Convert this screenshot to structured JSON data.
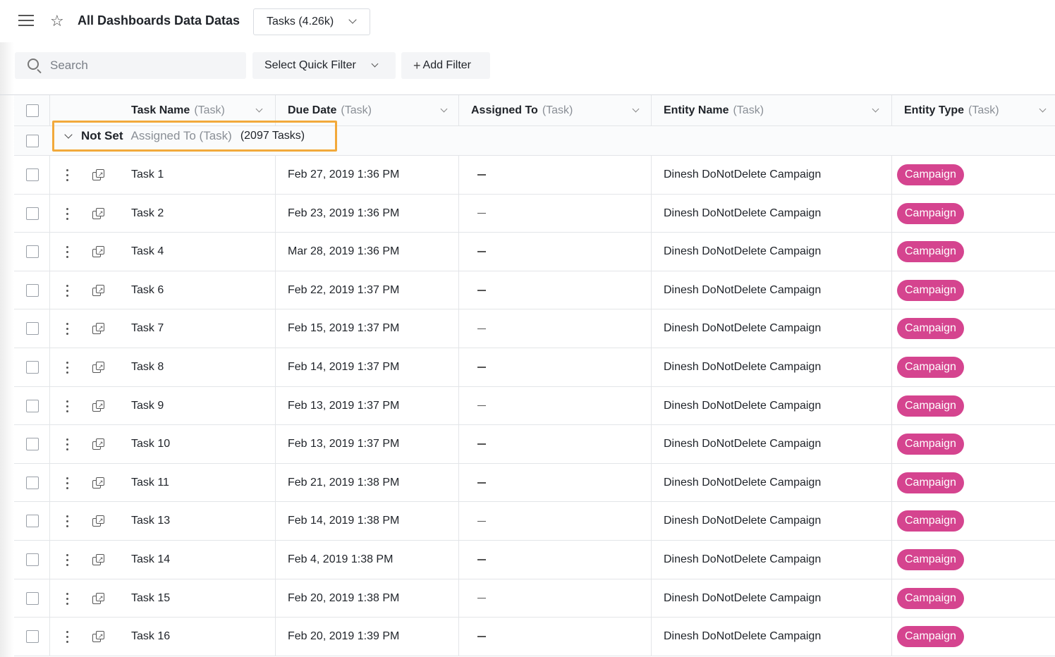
{
  "header": {
    "title": "All Dashboards Data Datas",
    "view_selector": "Tasks (4.26k)"
  },
  "filters": {
    "search_placeholder": "Search",
    "quick_filter_label": "Select Quick Filter",
    "add_filter_label": "Add Filter"
  },
  "table": {
    "columns": [
      {
        "name": "Task Name",
        "entity": "(Task)"
      },
      {
        "name": "Due Date",
        "entity": "(Task)"
      },
      {
        "name": "Assigned To",
        "entity": "(Task)"
      },
      {
        "name": "Entity Name",
        "entity": "(Task)"
      },
      {
        "name": "Entity Type",
        "entity": "(Task)"
      }
    ],
    "group": {
      "value": "Not Set",
      "field": "Assigned To (Task)",
      "count": "(2097 Tasks)"
    },
    "rows": [
      {
        "task": "Task 1",
        "due": "Feb 27, 2019 1:36 PM",
        "entity_name": "Dinesh DoNotDelete Campaign",
        "entity_type": "Campaign"
      },
      {
        "task": "Task 2",
        "due": "Feb 23, 2019 1:36 PM",
        "entity_name": "Dinesh DoNotDelete Campaign",
        "entity_type": "Campaign"
      },
      {
        "task": "Task 4",
        "due": "Mar 28, 2019 1:36 PM",
        "entity_name": "Dinesh DoNotDelete Campaign",
        "entity_type": "Campaign"
      },
      {
        "task": "Task 6",
        "due": "Feb 22, 2019 1:37 PM",
        "entity_name": "Dinesh DoNotDelete Campaign",
        "entity_type": "Campaign"
      },
      {
        "task": "Task 7",
        "due": "Feb 15, 2019 1:37 PM",
        "entity_name": "Dinesh DoNotDelete Campaign",
        "entity_type": "Campaign"
      },
      {
        "task": "Task 8",
        "due": "Feb 14, 2019 1:37 PM",
        "entity_name": "Dinesh DoNotDelete Campaign",
        "entity_type": "Campaign"
      },
      {
        "task": "Task 9",
        "due": "Feb 13, 2019 1:37 PM",
        "entity_name": "Dinesh DoNotDelete Campaign",
        "entity_type": "Campaign"
      },
      {
        "task": "Task 10",
        "due": "Feb 13, 2019 1:37 PM",
        "entity_name": "Dinesh DoNotDelete Campaign",
        "entity_type": "Campaign"
      },
      {
        "task": "Task 11",
        "due": "Feb 21, 2019 1:38 PM",
        "entity_name": "Dinesh DoNotDelete Campaign",
        "entity_type": "Campaign"
      },
      {
        "task": "Task 13",
        "due": "Feb 14, 2019 1:38 PM",
        "entity_name": "Dinesh DoNotDelete Campaign",
        "entity_type": "Campaign"
      },
      {
        "task": "Task 14",
        "due": "Feb 4, 2019 1:38 PM",
        "entity_name": "Dinesh DoNotDelete Campaign",
        "entity_type": "Campaign"
      },
      {
        "task": "Task 15",
        "due": "Feb 20, 2019 1:38 PM",
        "entity_name": "Dinesh DoNotDelete Campaign",
        "entity_type": "Campaign"
      },
      {
        "task": "Task 16",
        "due": "Feb 20, 2019 1:39 PM",
        "entity_name": "Dinesh DoNotDelete Campaign",
        "entity_type": "Campaign"
      }
    ]
  },
  "colors": {
    "badge": "#d5448f",
    "group_highlight": "#f2a93b"
  },
  "icons": {
    "menu": "hamburger-menu-icon",
    "favorite": "star-icon",
    "search": "search-icon",
    "row_actions": "kebab-menu-icon",
    "open_record": "open-record-icon"
  }
}
